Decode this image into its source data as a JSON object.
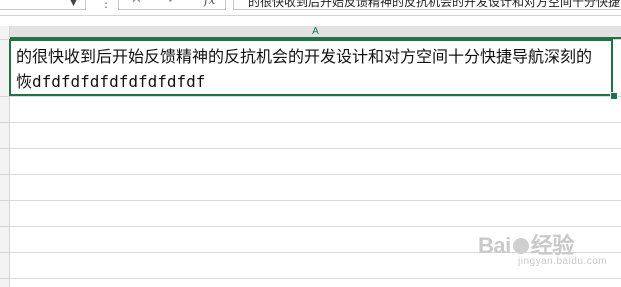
{
  "formula_bar": {
    "name_box": "",
    "separator": "⋮",
    "cancel_glyph": "✕",
    "enter_glyph": "✓",
    "fx_label": "fx",
    "content": "的很快收到后开始反馈精神的反抗机会的开发设计和对方空间十分快捷导航深刻的恢dfdfdfdfdfdfdfdfdfdf"
  },
  "columns": [
    "A"
  ],
  "active_cell": {
    "text": "的很快收到后开始反馈精神的反抗机会的开发设计和对方空间十分快捷导航深刻的恢dfdfdfdfdfdfdfdfdf"
  },
  "watermark": {
    "main_a": "Bai",
    "main_b": "经验",
    "sub": "jingyan.baidu.com"
  },
  "colors": {
    "accent": "#217346",
    "gridline": "#dadada",
    "header_bg": "#f3f3f3"
  }
}
